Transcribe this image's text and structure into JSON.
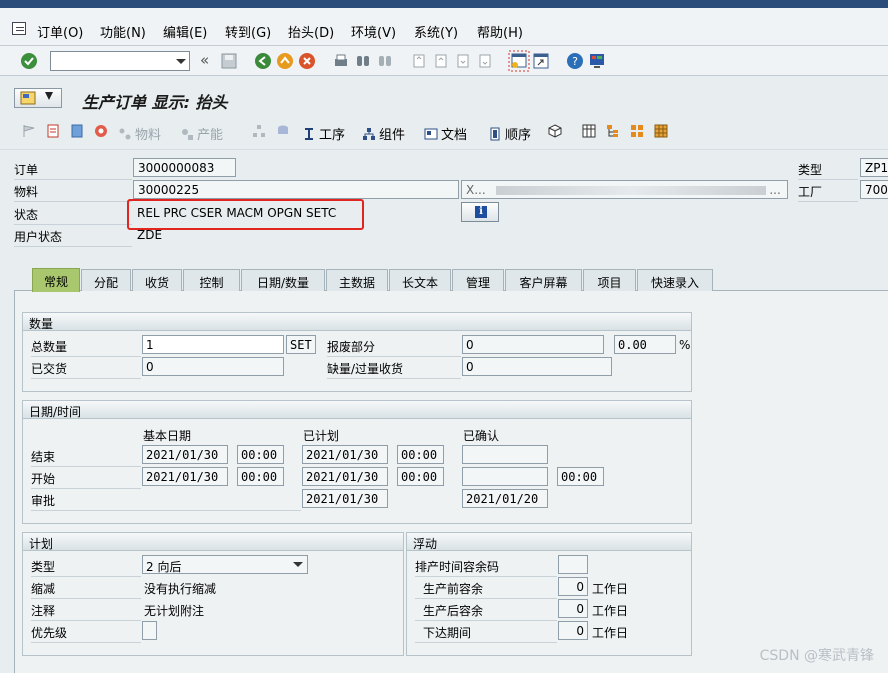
{
  "menu": {
    "items": [
      "订单(O)",
      "功能(N)",
      "编辑(E)",
      "转到(G)",
      "抬头(D)",
      "环境(V)",
      "系统(Y)",
      "帮助(H)"
    ]
  },
  "page": {
    "title": "生产订单 显示: 抬头"
  },
  "apptoolbar": {
    "material": "物料",
    "capacity": "产能",
    "operation": "工序",
    "component": "组件",
    "document": "文档",
    "sequence": "顺序"
  },
  "header": {
    "order_label": "订单",
    "order_value": "3000000083",
    "material_label": "物料",
    "material_value": "30000225",
    "material_desc": "X...",
    "material_desc_tail": "...",
    "status_label": "状态",
    "status_value": "REL  PRC  CSER MACM OPGN SETC",
    "userstatus_label": "用户状态",
    "userstatus_value": "ZDE",
    "type_label": "类型",
    "type_value": "ZP1",
    "plant_label": "工厂",
    "plant_value": "700"
  },
  "tabs": [
    "常规",
    "分配",
    "收货",
    "控制",
    "日期/数量",
    "主数据",
    "长文本",
    "管理",
    "客户屏幕",
    "项目",
    "快速录入"
  ],
  "quantity": {
    "title": "数量",
    "total_label": "总数量",
    "total_value": "1",
    "unit": "SET",
    "scrap_label": "报废部分",
    "scrap_value": "0",
    "scrap_pct": "0.00",
    "pct_sign": "%",
    "delivered_label": "已交货",
    "delivered_value": "0",
    "short_label": "缺量/过量收货",
    "short_value": "0"
  },
  "dates": {
    "title": "日期/时间",
    "col_basic": "基本日期",
    "col_sched": "已计划",
    "col_conf": "已确认",
    "end_label": "结束",
    "end_basic_date": "2021/01/30",
    "end_basic_time": "00:00",
    "end_sched_date": "2021/01/30",
    "end_sched_time": "00:00",
    "start_label": "开始",
    "start_basic_date": "2021/01/30",
    "start_basic_time": "00:00",
    "start_sched_date": "2021/01/30",
    "start_sched_time": "00:00",
    "start_conf_time": "00:00",
    "release_label": "审批",
    "release_sched_date": "2021/01/30",
    "release_conf_date": "2021/01/20"
  },
  "planning": {
    "title": "计划",
    "type_label": "类型",
    "type_value": "2 向后",
    "reduction_label": "缩减",
    "reduction_value": "没有执行缩减",
    "note_label": "注释",
    "note_value": "无计划附注",
    "priority_label": "优先级"
  },
  "float": {
    "title": "浮动",
    "sched_margin_label": "排产时间容余码",
    "before_label": "生产前容余",
    "before_value": "0",
    "after_label": "生产后容余",
    "after_value": "0",
    "release_label": "下达期间",
    "release_value": "0",
    "unit": "工作日"
  },
  "watermark": "CSDN @寒武青锋",
  "colors": {
    "active_tab": "#a9c86e",
    "highlight": "#e0261f",
    "background": "#e8eef0"
  }
}
